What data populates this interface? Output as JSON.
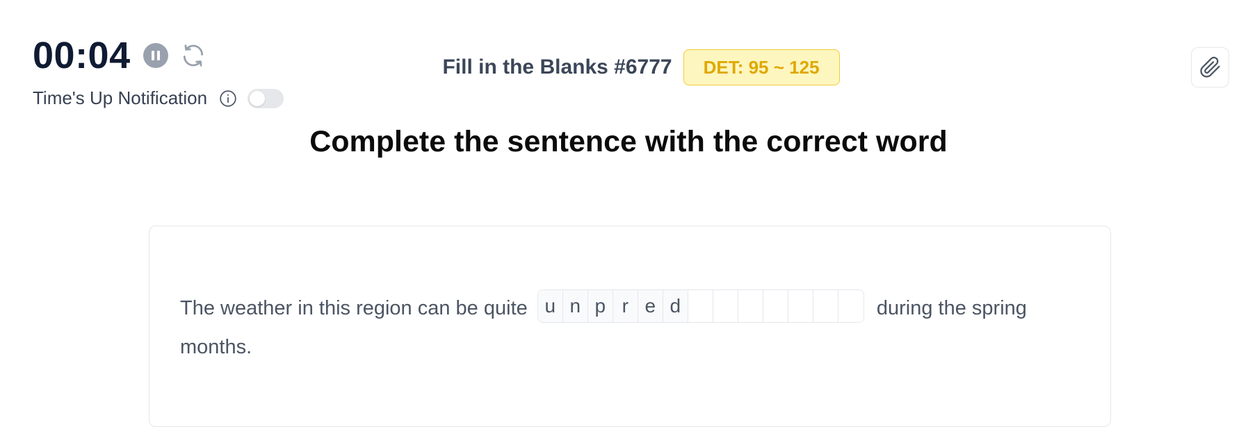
{
  "timer": {
    "value": "00:04"
  },
  "notification": {
    "label": "Time's Up Notification",
    "enabled": false
  },
  "question": {
    "title": "Fill in the Blanks #6777",
    "badge": "DET: 95 ~ 125"
  },
  "instruction": "Complete the sentence with the correct word",
  "sentence": {
    "before": "The weather in this region can be quite",
    "letters": [
      "u",
      "n",
      "p",
      "r",
      "e",
      "d",
      "",
      "",
      "",
      "",
      "",
      "",
      ""
    ],
    "after": "during the spring months."
  },
  "icons": {
    "pause": "pause-icon",
    "reset": "refresh-icon",
    "info": "info-icon",
    "attach": "paperclip-icon"
  },
  "colors": {
    "timer": "#0f1b33",
    "badge_text": "#e0a800",
    "badge_bg": "#fef6bf",
    "badge_border": "#f2cb3a"
  }
}
